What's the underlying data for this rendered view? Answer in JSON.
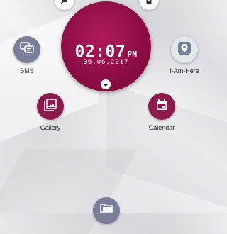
{
  "clock": {
    "time": "02:07",
    "ampm": "PM",
    "date": "06.06.2017"
  },
  "status_icons": {
    "left": "bell-off-icon",
    "right": "phone-icon"
  },
  "apps": {
    "sms": {
      "label": "SMS",
      "icon": "message-icon"
    },
    "iamhere": {
      "label": "I-Am-Here",
      "icon": "location-pin-icon"
    },
    "gallery": {
      "label": "Gallery",
      "icon": "gallery-icon"
    },
    "calendar": {
      "label": "Calendar",
      "icon": "calendar-icon"
    },
    "files": {
      "icon": "folder-icon"
    }
  },
  "colors": {
    "accent": "#8e0d46",
    "sms_bg": "#7a7f99"
  }
}
